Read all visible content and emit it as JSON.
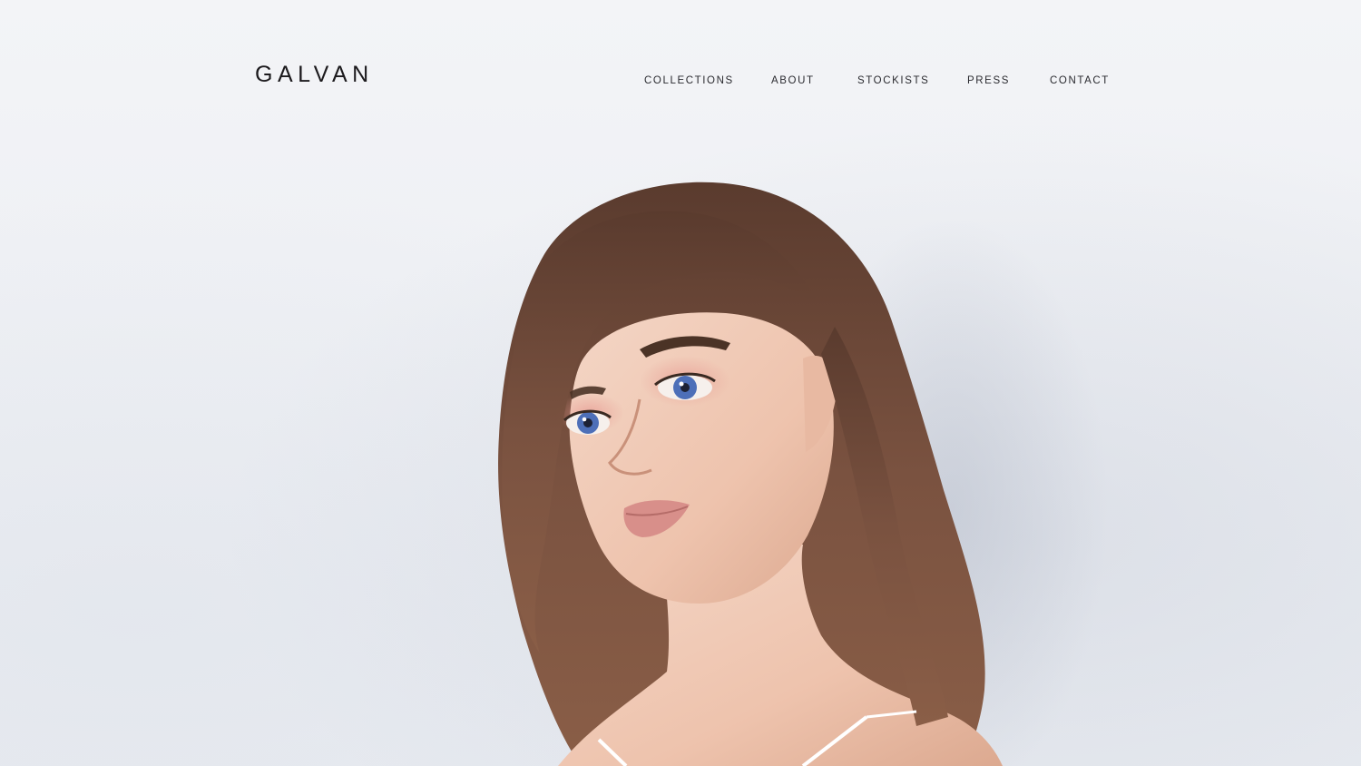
{
  "brand": {
    "logo_text": "GALVAN"
  },
  "nav": {
    "items": [
      {
        "label": "COLLECTIONS"
      },
      {
        "label": "ABOUT"
      },
      {
        "label": "STOCKISTS"
      },
      {
        "label": "PRESS"
      },
      {
        "label": "CONTACT"
      }
    ]
  },
  "hero": {
    "image_icon": "portrait-photo",
    "colors": {
      "background": "#eff1f5",
      "hair": "#6e4a39",
      "skin": "#eec8b4",
      "eyes": "#4d6fb8"
    }
  }
}
